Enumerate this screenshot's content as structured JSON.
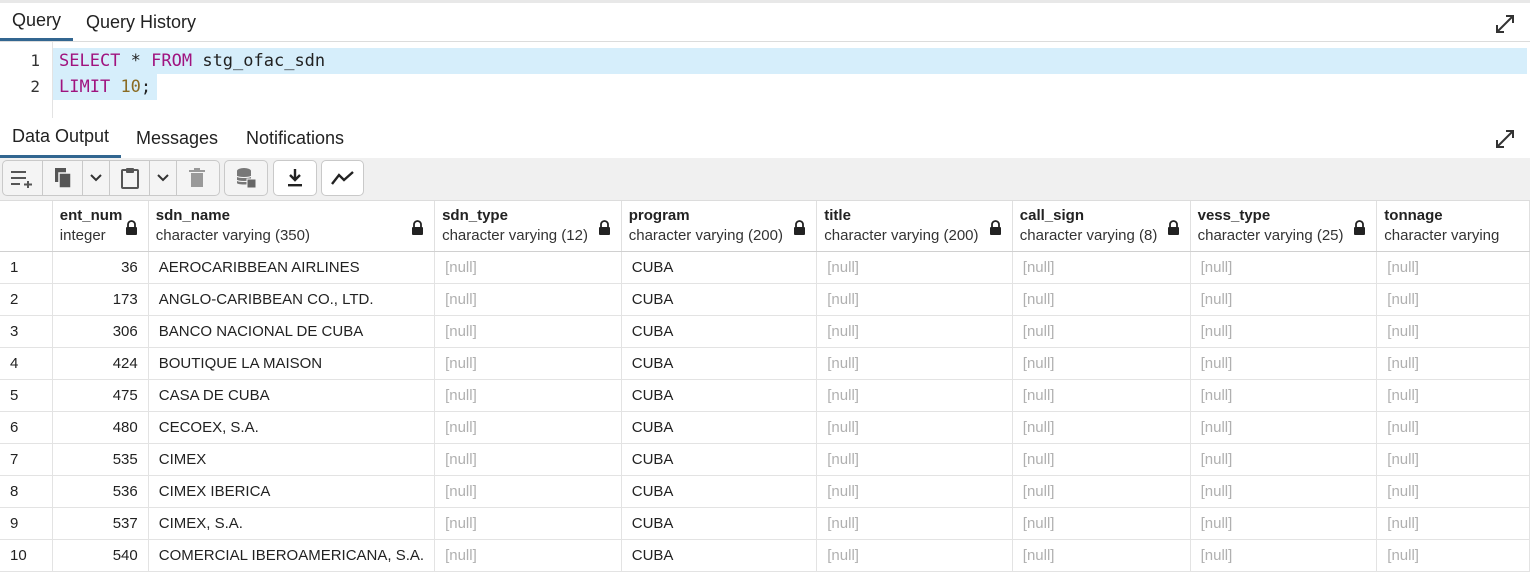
{
  "query_tabs": [
    {
      "label": "Query",
      "active": true
    },
    {
      "label": "Query History",
      "active": false
    }
  ],
  "editor": {
    "line_numbers": [
      "1",
      "2"
    ],
    "line1": {
      "kw1": "SELECT",
      "op": " * ",
      "kw2": "FROM",
      "table": " stg_ofac_sdn"
    },
    "line2": {
      "kw": "LIMIT",
      "sp": " ",
      "num": "10",
      "end": ";"
    }
  },
  "output_tabs": [
    {
      "label": "Data Output",
      "active": true
    },
    {
      "label": "Messages",
      "active": false
    },
    {
      "label": "Notifications",
      "active": false
    }
  ],
  "toolbar_icons": [
    "add-row-icon",
    "copy-icon",
    "chevron-down-icon",
    "paste-icon",
    "chevron-down-icon",
    "delete-icon",
    "save-data-icon",
    "download-icon",
    "graph-icon"
  ],
  "columns": [
    {
      "name": "ent_num",
      "type": "integer"
    },
    {
      "name": "sdn_name",
      "type": "character varying (350)"
    },
    {
      "name": "sdn_type",
      "type": "character varying (12)"
    },
    {
      "name": "program",
      "type": "character varying (200)"
    },
    {
      "name": "title",
      "type": "character varying (200)"
    },
    {
      "name": "call_sign",
      "type": "character varying (8)"
    },
    {
      "name": "vess_type",
      "type": "character varying (25)"
    },
    {
      "name": "tonnage",
      "type": "character varying"
    }
  ],
  "rows": [
    {
      "n": "1",
      "ent_num": "36",
      "sdn_name": "AEROCARIBBEAN AIRLINES",
      "sdn_type": "[null]",
      "program": "CUBA",
      "title": "[null]",
      "call_sign": "[null]",
      "vess_type": "[null]",
      "tonnage": "[null]"
    },
    {
      "n": "2",
      "ent_num": "173",
      "sdn_name": "ANGLO-CARIBBEAN CO., LTD.",
      "sdn_type": "[null]",
      "program": "CUBA",
      "title": "[null]",
      "call_sign": "[null]",
      "vess_type": "[null]",
      "tonnage": "[null]"
    },
    {
      "n": "3",
      "ent_num": "306",
      "sdn_name": "BANCO NACIONAL DE CUBA",
      "sdn_type": "[null]",
      "program": "CUBA",
      "title": "[null]",
      "call_sign": "[null]",
      "vess_type": "[null]",
      "tonnage": "[null]"
    },
    {
      "n": "4",
      "ent_num": "424",
      "sdn_name": "BOUTIQUE LA MAISON",
      "sdn_type": "[null]",
      "program": "CUBA",
      "title": "[null]",
      "call_sign": "[null]",
      "vess_type": "[null]",
      "tonnage": "[null]"
    },
    {
      "n": "5",
      "ent_num": "475",
      "sdn_name": "CASA DE CUBA",
      "sdn_type": "[null]",
      "program": "CUBA",
      "title": "[null]",
      "call_sign": "[null]",
      "vess_type": "[null]",
      "tonnage": "[null]"
    },
    {
      "n": "6",
      "ent_num": "480",
      "sdn_name": "CECOEX, S.A.",
      "sdn_type": "[null]",
      "program": "CUBA",
      "title": "[null]",
      "call_sign": "[null]",
      "vess_type": "[null]",
      "tonnage": "[null]"
    },
    {
      "n": "7",
      "ent_num": "535",
      "sdn_name": "CIMEX",
      "sdn_type": "[null]",
      "program": "CUBA",
      "title": "[null]",
      "call_sign": "[null]",
      "vess_type": "[null]",
      "tonnage": "[null]"
    },
    {
      "n": "8",
      "ent_num": "536",
      "sdn_name": "CIMEX IBERICA",
      "sdn_type": "[null]",
      "program": "CUBA",
      "title": "[null]",
      "call_sign": "[null]",
      "vess_type": "[null]",
      "tonnage": "[null]"
    },
    {
      "n": "9",
      "ent_num": "537",
      "sdn_name": "CIMEX, S.A.",
      "sdn_type": "[null]",
      "program": "CUBA",
      "title": "[null]",
      "call_sign": "[null]",
      "vess_type": "[null]",
      "tonnage": "[null]"
    },
    {
      "n": "10",
      "ent_num": "540",
      "sdn_name": "COMERCIAL IBEROAMERICANA, S.A.",
      "sdn_type": "[null]",
      "program": "CUBA",
      "title": "[null]",
      "call_sign": "[null]",
      "vess_type": "[null]",
      "tonnage": "[null]"
    }
  ]
}
